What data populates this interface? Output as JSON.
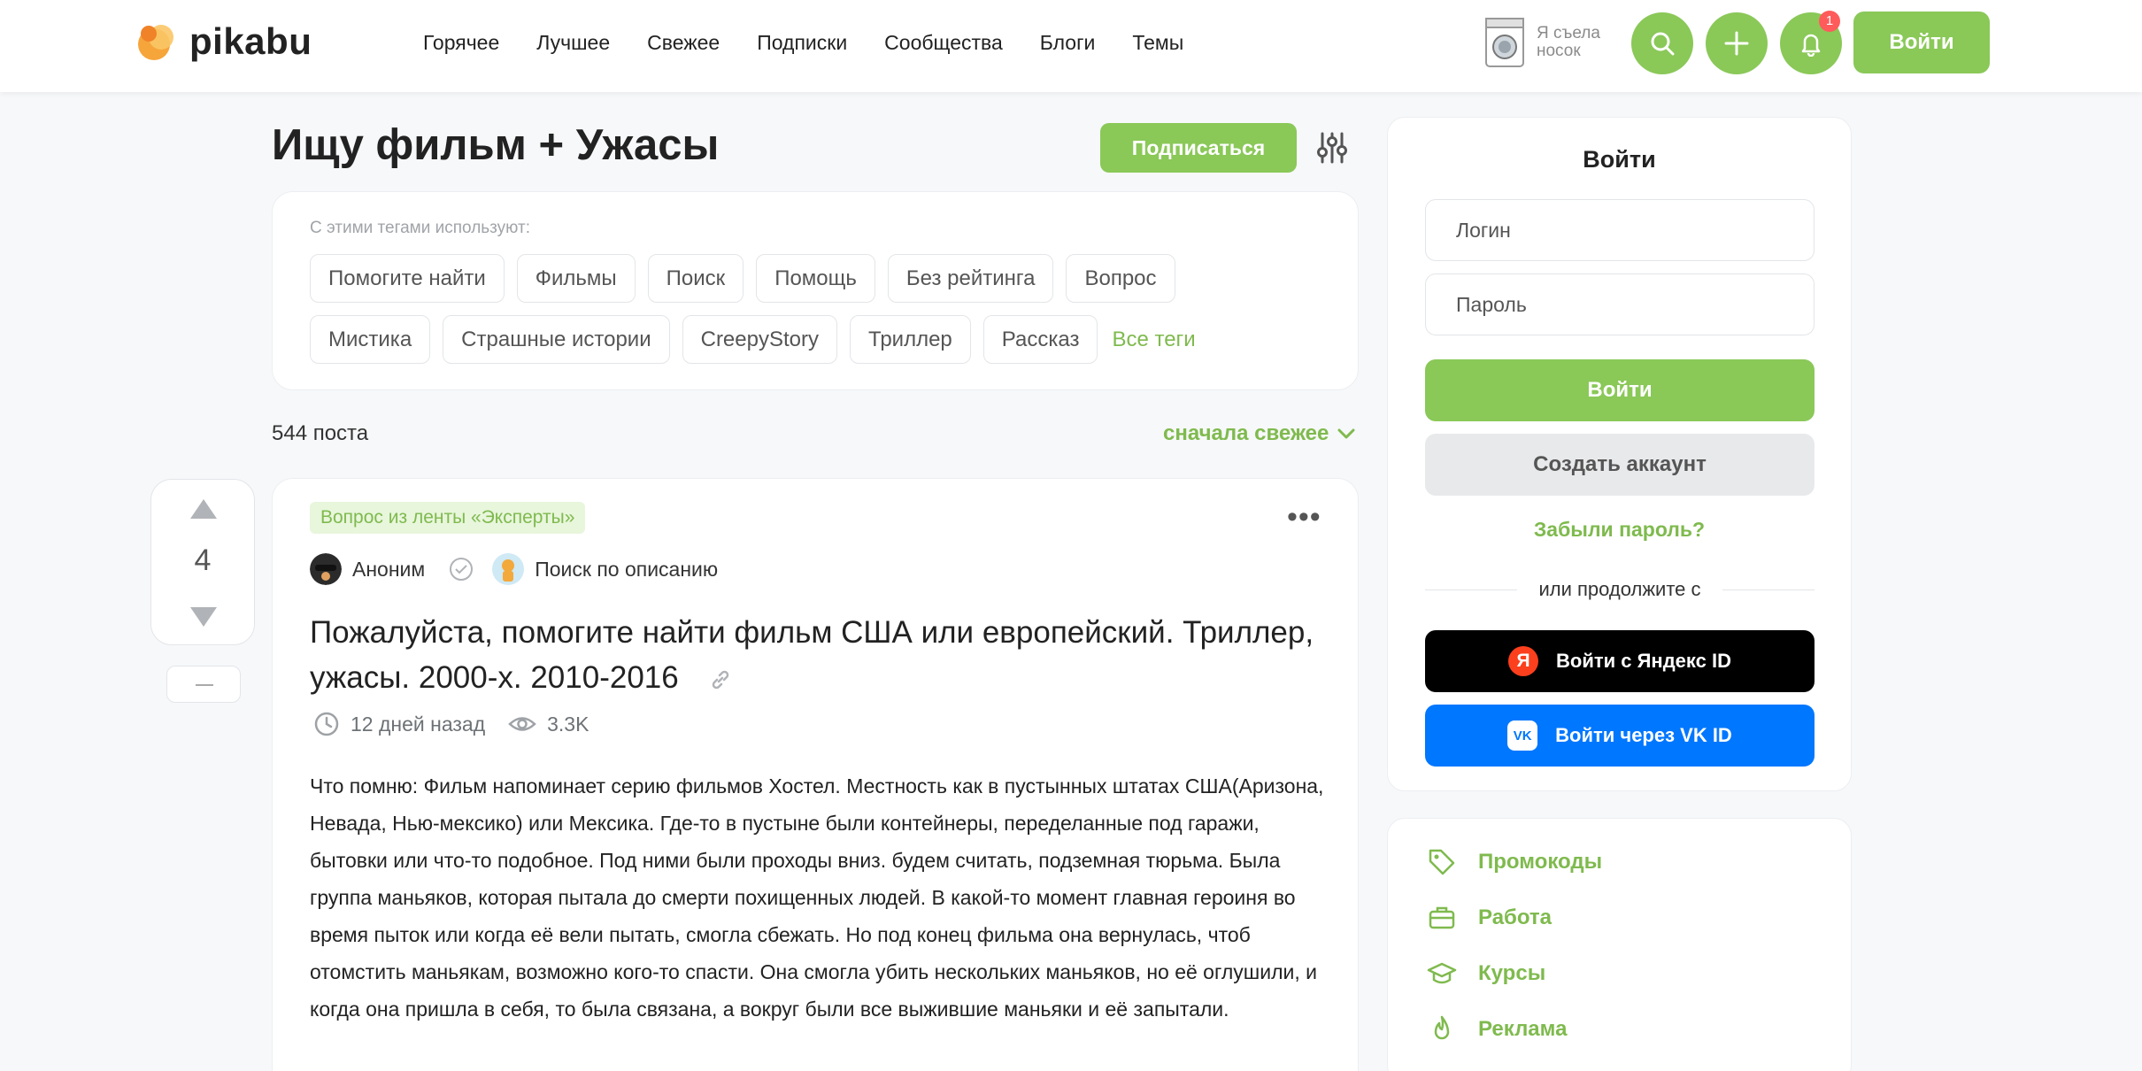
{
  "header": {
    "logo_text": "pikabu",
    "nav": [
      "Горячее",
      "Лучшее",
      "Свежее",
      "Подписки",
      "Сообщества",
      "Блоги",
      "Темы"
    ],
    "promo_text": "Я съела носок",
    "notification_count": "1",
    "login_label": "Войти",
    "icons": [
      "search-icon",
      "plus-icon",
      "bell-icon"
    ]
  },
  "page": {
    "title": "Ищу фильм + Ужасы",
    "subscribe_label": "Подписаться",
    "tags_label": "С этими тегами используют:",
    "tags_row1": [
      "Помогите найти",
      "Фильмы",
      "Поиск",
      "Помощь",
      "Без рейтинга",
      "Вопрос"
    ],
    "tags_row2": [
      "Мистика",
      "Страшные истории",
      "CreepyStory",
      "Триллер",
      "Рассказ"
    ],
    "all_tags_label": "Все теги",
    "posts_count": "544 поста",
    "sort_label": "сначала свежее"
  },
  "post": {
    "votes": "4",
    "badge": "Вопрос из ленты «Эксперты»",
    "author": "Аноним",
    "community": "Поиск по описанию",
    "title": "Пожалуйста, помогите найти фильм США или европейский. Триллер, ужасы. 2000-х. 2010-2016",
    "time": "12 дней назад",
    "views": "3.3K",
    "body": "Что помню: Фильм напоминает серию фильмов Хостел. Местность как в пустынных штатах США(Аризона, Невада, Нью-мексико) или Мексика. Где-то в пустыне были контейнеры, переделанные под гаражи, бытовки или что-то подобное. Под ними были проходы вниз. будем считать, подземная тюрьма. Была группа маньяков, которая пытала до смерти похищенных людей. В какой-то момент главная героиня во время пыток или когда её вели пытать, смогла сбежать. Но под конец фильма она вернулась, чтоб отомстить маньякам, возможно кого-то спасти. Она смогла убить нескольких маньяков, но её оглушили, и когда она пришла в себя, то была связана, а вокруг были все выжившие маньяки и её запытали."
  },
  "sidebar": {
    "title": "Войти",
    "login_placeholder": "Логин",
    "password_placeholder": "Пароль",
    "login_button": "Войти",
    "create_button": "Создать аккаунт",
    "forgot": "Забыли пароль?",
    "or_text": "или продолжите с",
    "yandex_button": "Войти с Яндекс ID",
    "yandex_logo": "Я",
    "vk_button": "Войти через VK ID",
    "vk_logo": "VK",
    "links": [
      "Промокоды",
      "Работа",
      "Курсы",
      "Реклама"
    ]
  },
  "colors": {
    "accent": "#8ac858",
    "accent_text": "#7fba4e",
    "yandex": "#000000",
    "vk": "#0077ff"
  }
}
